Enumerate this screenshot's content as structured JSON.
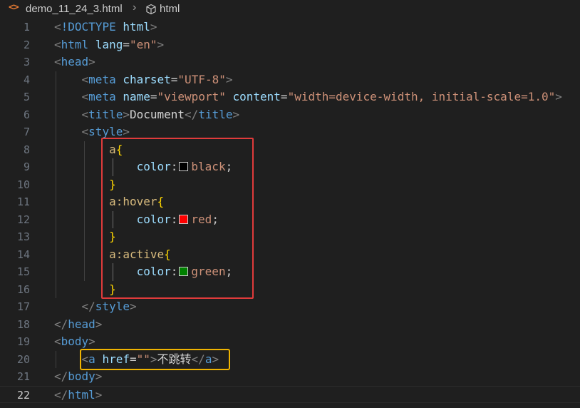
{
  "breadcrumb": {
    "file_icon": "<>",
    "file_name": "demo_11_24_3.html",
    "separator": "›",
    "element_icon": "cube-icon",
    "element_name": "html"
  },
  "colors": {
    "swatch_black": "#000000",
    "swatch_red": "#ff0000",
    "swatch_green": "#008000",
    "annotation_red": "#e03b3b",
    "annotation_yellow": "#f0b400"
  },
  "lines": [
    {
      "n": "1",
      "tokens": [
        [
          "tok-bracket",
          "<"
        ],
        [
          "tok-tag",
          "!DOCTYPE "
        ],
        [
          "tok-attr",
          "html"
        ],
        [
          "tok-bracket",
          ">"
        ]
      ]
    },
    {
      "n": "2",
      "tokens": [
        [
          "tok-bracket",
          "<"
        ],
        [
          "tok-tag",
          "html"
        ],
        [
          "tok-punct",
          " "
        ],
        [
          "tok-attr",
          "lang"
        ],
        [
          "tok-eq",
          "="
        ],
        [
          "tok-str",
          "\"en\""
        ],
        [
          "tok-bracket",
          ">"
        ]
      ]
    },
    {
      "n": "3",
      "tokens": [
        [
          "tok-bracket",
          "<"
        ],
        [
          "tok-tag",
          "head"
        ],
        [
          "tok-bracket",
          ">"
        ]
      ]
    },
    {
      "n": "4",
      "tokens": [
        [
          "tok-punct",
          "    "
        ],
        [
          "tok-bracket",
          "<"
        ],
        [
          "tok-tag",
          "meta"
        ],
        [
          "tok-punct",
          " "
        ],
        [
          "tok-attr",
          "charset"
        ],
        [
          "tok-eq",
          "="
        ],
        [
          "tok-str",
          "\"UTF-8\""
        ],
        [
          "tok-bracket",
          ">"
        ]
      ]
    },
    {
      "n": "5",
      "tokens": [
        [
          "tok-punct",
          "    "
        ],
        [
          "tok-bracket",
          "<"
        ],
        [
          "tok-tag",
          "meta"
        ],
        [
          "tok-punct",
          " "
        ],
        [
          "tok-attr",
          "name"
        ],
        [
          "tok-eq",
          "="
        ],
        [
          "tok-str",
          "\"viewport\""
        ],
        [
          "tok-punct",
          " "
        ],
        [
          "tok-attr",
          "content"
        ],
        [
          "tok-eq",
          "="
        ],
        [
          "tok-str",
          "\"width=device-width, initial-scale=1.0\""
        ],
        [
          "tok-bracket",
          ">"
        ]
      ]
    },
    {
      "n": "6",
      "tokens": [
        [
          "tok-punct",
          "    "
        ],
        [
          "tok-bracket",
          "<"
        ],
        [
          "tok-tag",
          "title"
        ],
        [
          "tok-bracket",
          ">"
        ],
        [
          "tok-text",
          "Document"
        ],
        [
          "tok-bracket",
          "</"
        ],
        [
          "tok-tag",
          "title"
        ],
        [
          "tok-bracket",
          ">"
        ]
      ]
    },
    {
      "n": "7",
      "tokens": [
        [
          "tok-punct",
          "    "
        ],
        [
          "tok-bracket",
          "<"
        ],
        [
          "tok-tag",
          "style"
        ],
        [
          "tok-bracket",
          ">"
        ]
      ]
    },
    {
      "n": "8",
      "tokens": [
        [
          "tok-punct",
          "        "
        ],
        [
          "tok-sel",
          "a"
        ],
        [
          "tok-brace",
          "{"
        ]
      ]
    },
    {
      "n": "9",
      "tokens": [
        [
          "tok-punct",
          "            "
        ],
        [
          "tok-prop",
          "color"
        ],
        [
          "tok-punct",
          ":"
        ],
        [
          "swatch",
          "#000000"
        ],
        [
          "tok-val",
          "black"
        ],
        [
          "tok-punct",
          ";"
        ]
      ]
    },
    {
      "n": "10",
      "tokens": [
        [
          "tok-punct",
          "        "
        ],
        [
          "tok-brace",
          "}"
        ]
      ]
    },
    {
      "n": "11",
      "tokens": [
        [
          "tok-punct",
          "        "
        ],
        [
          "tok-sel",
          "a:hover"
        ],
        [
          "tok-brace",
          "{"
        ]
      ]
    },
    {
      "n": "12",
      "tokens": [
        [
          "tok-punct",
          "            "
        ],
        [
          "tok-prop",
          "color"
        ],
        [
          "tok-punct",
          ":"
        ],
        [
          "swatch",
          "#ff0000"
        ],
        [
          "tok-val",
          "red"
        ],
        [
          "tok-punct",
          ";"
        ]
      ]
    },
    {
      "n": "13",
      "tokens": [
        [
          "tok-punct",
          "        "
        ],
        [
          "tok-brace",
          "}"
        ]
      ]
    },
    {
      "n": "14",
      "tokens": [
        [
          "tok-punct",
          "        "
        ],
        [
          "tok-sel",
          "a:active"
        ],
        [
          "tok-brace",
          "{"
        ]
      ]
    },
    {
      "n": "15",
      "tokens": [
        [
          "tok-punct",
          "            "
        ],
        [
          "tok-prop",
          "color"
        ],
        [
          "tok-punct",
          ":"
        ],
        [
          "swatch",
          "#008000"
        ],
        [
          "tok-val",
          "green"
        ],
        [
          "tok-punct",
          ";"
        ]
      ]
    },
    {
      "n": "16",
      "tokens": [
        [
          "tok-punct",
          "        "
        ],
        [
          "tok-brace",
          "}"
        ]
      ]
    },
    {
      "n": "17",
      "tokens": [
        [
          "tok-punct",
          "    "
        ],
        [
          "tok-bracket",
          "</"
        ],
        [
          "tok-tag",
          "style"
        ],
        [
          "tok-bracket",
          ">"
        ]
      ]
    },
    {
      "n": "18",
      "tokens": [
        [
          "tok-bracket",
          "</"
        ],
        [
          "tok-tag",
          "head"
        ],
        [
          "tok-bracket",
          ">"
        ]
      ]
    },
    {
      "n": "19",
      "tokens": [
        [
          "tok-bracket",
          "<"
        ],
        [
          "tok-tag",
          "body"
        ],
        [
          "tok-bracket",
          ">"
        ]
      ]
    },
    {
      "n": "20",
      "tokens": [
        [
          "tok-punct",
          "    "
        ],
        [
          "tok-bracket",
          "<"
        ],
        [
          "tok-tag",
          "a"
        ],
        [
          "tok-punct",
          " "
        ],
        [
          "tok-attr",
          "href"
        ],
        [
          "tok-eq",
          "="
        ],
        [
          "tok-str",
          "\"\""
        ],
        [
          "tok-bracket",
          ">"
        ],
        [
          "tok-text",
          "不跳转"
        ],
        [
          "tok-bracket",
          "</"
        ],
        [
          "tok-tag",
          "a"
        ],
        [
          "tok-bracket",
          ">"
        ]
      ]
    },
    {
      "n": "21",
      "tokens": [
        [
          "tok-bracket",
          "</"
        ],
        [
          "tok-tag",
          "body"
        ],
        [
          "tok-bracket",
          ">"
        ]
      ]
    },
    {
      "n": "22",
      "tokens": [
        [
          "tok-bracket",
          "</"
        ],
        [
          "tok-tag",
          "html"
        ],
        [
          "tok-bracket",
          ">"
        ]
      ]
    }
  ],
  "current_line": "22"
}
